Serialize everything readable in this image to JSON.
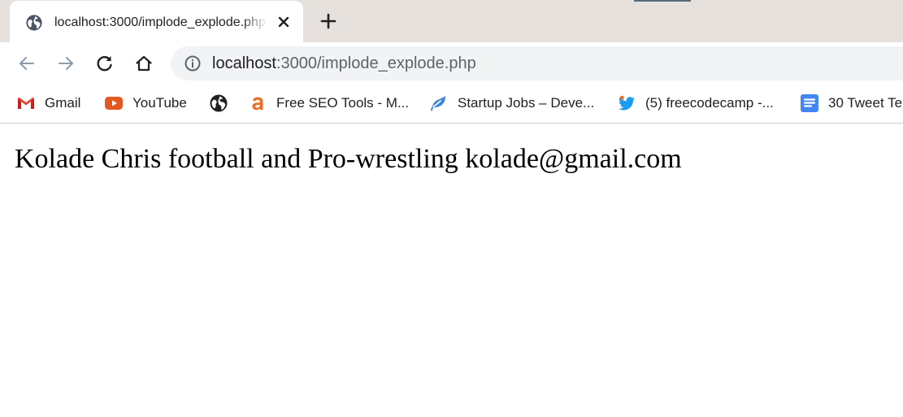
{
  "browser": {
    "tab": {
      "title": "localhost:3000/implode_explode.php",
      "favicon": "globe-icon",
      "close_icon": "close-icon"
    },
    "new_tab_icon": "plus-icon",
    "toolbar": {
      "back_icon": "arrow-left-icon",
      "forward_icon": "arrow-right-icon",
      "reload_icon": "reload-icon",
      "home_icon": "home-icon"
    },
    "omnibox": {
      "info_icon": "info-icon",
      "url_host": "localhost",
      "url_rest": ":3000/implode_explode.php"
    },
    "bookmarks": [
      {
        "label": "Gmail",
        "icon": "gmail-icon"
      },
      {
        "label": "YouTube",
        "icon": "youtube-icon"
      },
      {
        "label": "",
        "icon": "globe-icon"
      },
      {
        "label": "Free SEO Tools - M...",
        "icon": "seo-tools-icon"
      },
      {
        "label": "Startup Jobs – Deve...",
        "icon": "startup-jobs-icon"
      },
      {
        "label": "(5) freecodecamp -...",
        "icon": "twitter-icon"
      },
      {
        "label": "30 Tweet Te",
        "icon": "document-icon"
      }
    ]
  },
  "page": {
    "output_text": "Kolade Chris football and Pro-wrestling kolade@gmail.com"
  },
  "colors": {
    "tabstrip_bg": "#e6e1dd",
    "omnibox_bg": "#f1f3f4",
    "gmail_red": "#ea4335",
    "youtube_orange": "#e2581f",
    "seo_orange": "#e8702a",
    "twitter_blue": "#1d9bf0",
    "docs_blue": "#4285f4"
  }
}
